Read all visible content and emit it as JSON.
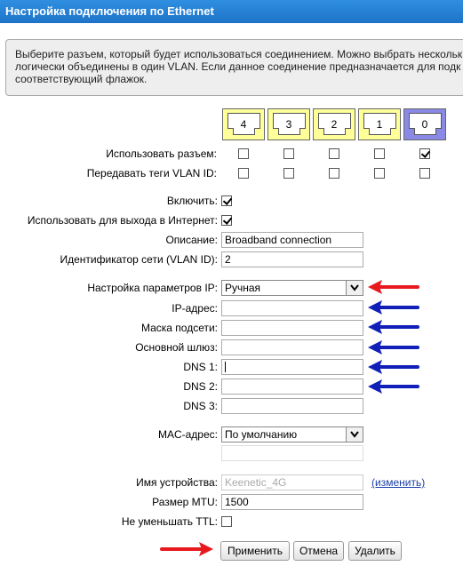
{
  "title": "Настройка подключения по Ethernet",
  "info": {
    "line1": "Выберите разъем, который будет использоваться соединением. Можно выбрать нескольк",
    "line2": "логически объединены в один VLAN. Если данное соединение предназначается для подк",
    "line3": "соответствующий флажок."
  },
  "ports": [
    {
      "num": "4",
      "use": false,
      "vlan": false
    },
    {
      "num": "3",
      "use": false,
      "vlan": false
    },
    {
      "num": "2",
      "use": false,
      "vlan": false
    },
    {
      "num": "1",
      "use": false,
      "vlan": false
    },
    {
      "num": "0",
      "use": true,
      "vlan": false
    }
  ],
  "labels": {
    "use_port": "Использовать разъем:",
    "vlan_tags": "Передавать теги VLAN ID:",
    "enable": "Включить:",
    "internet": "Использовать для выхода в Интернет:",
    "description": "Описание:",
    "vlan_id": "Идентификатор сети (VLAN ID):",
    "ip_settings": "Настройка параметров IP:",
    "ip_address": "IP-адрес:",
    "subnet_mask": "Маска подсети:",
    "gateway": "Основной шлюз:",
    "dns1": "DNS 1:",
    "dns2": "DNS 2:",
    "dns3": "DNS 3:",
    "mac": "MAC-адрес:",
    "device_name": "Имя устройства:",
    "mtu": "Размер MTU:",
    "ttl": "Не уменьшать TTL:"
  },
  "values": {
    "enable": true,
    "internet": true,
    "description": "Broadband connection",
    "vlan_id": "2",
    "ip_settings": "Ручная",
    "ip_address": "",
    "subnet_mask": "",
    "gateway": "",
    "dns1": "",
    "dns2": "",
    "dns3": "",
    "mac": "По умолчанию",
    "mac_custom": "",
    "device_name": "Keenetic_4G",
    "mtu": "1500",
    "ttl": false
  },
  "change_link": "(изменить)",
  "buttons": {
    "apply": "Применить",
    "cancel": "Отмена",
    "delete": "Удалить"
  },
  "arrow_colors": {
    "red": "#e8191e",
    "blue": "#0f1fb8"
  }
}
